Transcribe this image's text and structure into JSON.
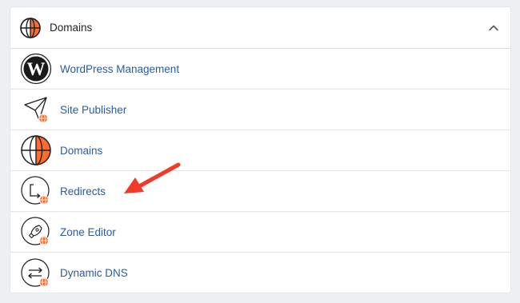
{
  "section": {
    "title": "Domains",
    "header_icon": "globe-icon",
    "collapse_icon": "chevron-up-icon"
  },
  "items": [
    {
      "label": "WordPress Management",
      "icon": "wordpress-icon"
    },
    {
      "label": "Site Publisher",
      "icon": "paper-plane-icon"
    },
    {
      "label": "Domains",
      "icon": "globe-icon"
    },
    {
      "label": "Redirects",
      "icon": "redirect-icon"
    },
    {
      "label": "Zone Editor",
      "icon": "rocket-icon"
    },
    {
      "label": "Dynamic DNS",
      "icon": "swap-arrows-icon"
    }
  ],
  "colors": {
    "accent": "#ff6c2c",
    "link": "#2b5c9e",
    "annotation_arrow": "#f03a2a"
  }
}
